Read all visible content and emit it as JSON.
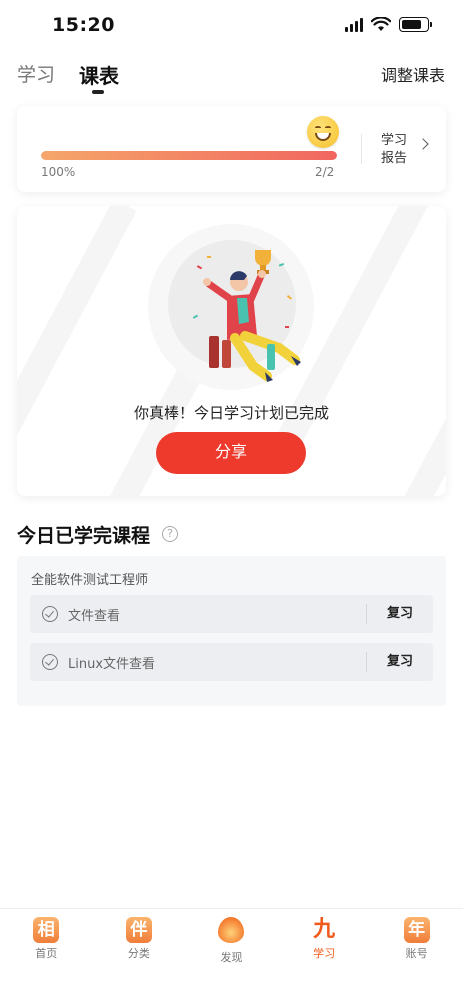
{
  "status_bar": {
    "time": "15:20"
  },
  "top_tabs": [
    {
      "label": "学习",
      "active": false
    },
    {
      "label": "课表",
      "active": true
    }
  ],
  "adjust_schedule": "调整课表",
  "progress": {
    "fraction": 1.0,
    "percent_label": "100%",
    "count_label": "2/2",
    "report_line1": "学习",
    "report_line2": "报告"
  },
  "celebration": {
    "message": "你真棒！今日学习计划已完成",
    "share_label": "分享"
  },
  "completed": {
    "title": "今日已学完课程",
    "help_glyph": "?",
    "course_name": "全能软件测试工程师",
    "lessons": [
      {
        "title": "文件查看",
        "action": "复习"
      },
      {
        "title": "Linux文件查看",
        "action": "复习"
      }
    ]
  },
  "bottom_nav": [
    {
      "glyph": "相",
      "label": "首页",
      "icon": "home-icon",
      "active": false
    },
    {
      "glyph": "伴",
      "label": "分类",
      "icon": "category-icon",
      "active": false
    },
    {
      "glyph": "",
      "label": "发现",
      "icon": "flame-icon",
      "active": false
    },
    {
      "glyph": "九",
      "label": "学习",
      "icon": "study-icon",
      "active": true
    },
    {
      "glyph": "年",
      "label": "账号",
      "icon": "account-icon",
      "active": false
    }
  ],
  "colors": {
    "accent": "#ee3a2c",
    "active_nav": "#f05a1a",
    "bar_start": "#f5a66a",
    "bar_end": "#f16660"
  }
}
